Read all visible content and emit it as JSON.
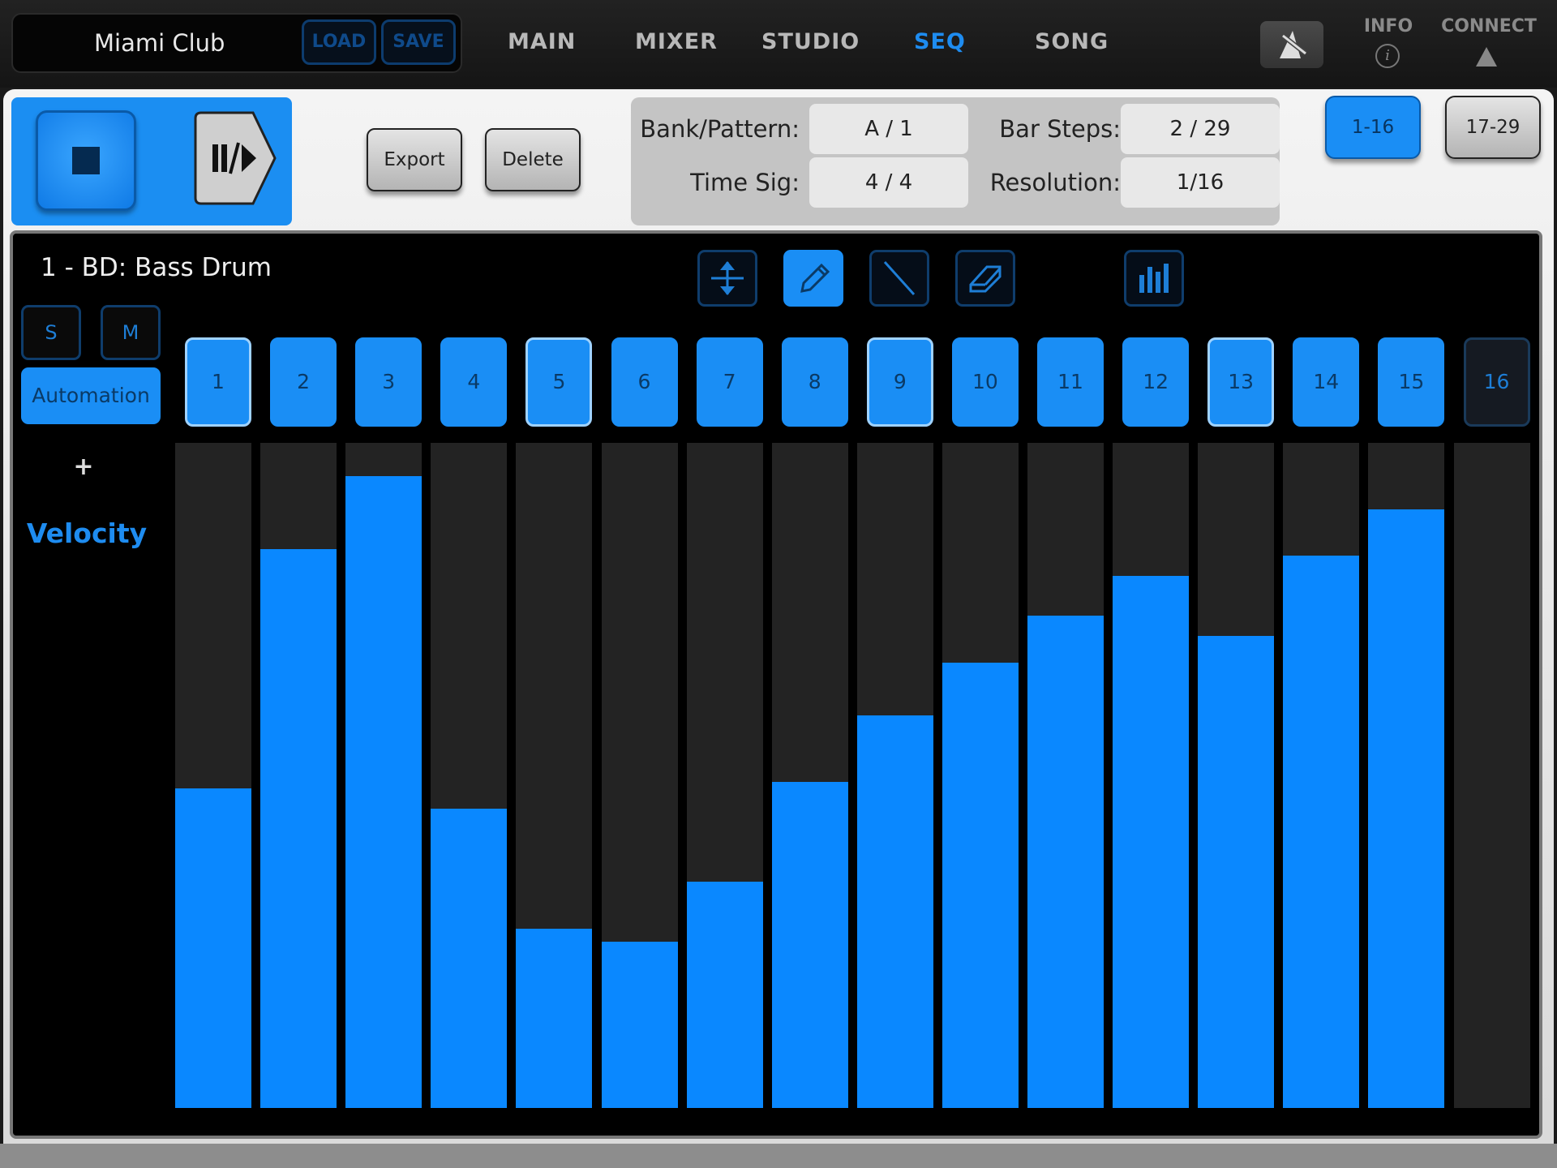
{
  "header": {
    "preset_name": "Miami Club",
    "load_label": "LOAD",
    "save_label": "SAVE",
    "nav": [
      {
        "label": "MAIN",
        "active": false
      },
      {
        "label": "MIXER",
        "active": false
      },
      {
        "label": "STUDIO",
        "active": false
      },
      {
        "label": "SEQ",
        "active": true
      },
      {
        "label": "SONG",
        "active": false
      }
    ],
    "info_label": "INFO",
    "connect_label": "CONNECT"
  },
  "transport": {
    "stop_icon": "stop-icon",
    "play_icon": "pause-play-icon"
  },
  "actions": {
    "export_label": "Export",
    "delete_label": "Delete"
  },
  "pattern_info": {
    "bank_pattern_label": "Bank/Pattern:",
    "bank_pattern_value": "A / 1",
    "bar_steps_label": "Bar Steps:",
    "bar_steps_value": "2 / 29",
    "time_sig_label": "Time Sig:",
    "time_sig_value": "4 / 4",
    "resolution_label": "Resolution:",
    "resolution_value": "1/16"
  },
  "pages": [
    {
      "label": "1-16",
      "active": true
    },
    {
      "label": "17-29",
      "active": false
    }
  ],
  "sequencer": {
    "track_name": "1 - BD: Bass Drum",
    "solo_label": "S",
    "mute_label": "M",
    "automation_label": "Automation",
    "plus_label": "+",
    "param_label": "Velocity",
    "tools": [
      {
        "name": "move-vertical-icon",
        "active": false
      },
      {
        "name": "pencil-icon",
        "active": true
      },
      {
        "name": "line-icon",
        "active": false
      },
      {
        "name": "eraser-icon",
        "active": false
      },
      {
        "name": "bar-graph-icon",
        "active": false
      }
    ],
    "accent_color": "#0a88ff",
    "steps": [
      {
        "label": "1",
        "state": "ring",
        "velocity": 0.48
      },
      {
        "label": "2",
        "state": "on",
        "velocity": 0.84
      },
      {
        "label": "3",
        "state": "on",
        "velocity": 0.95
      },
      {
        "label": "4",
        "state": "on",
        "velocity": 0.45
      },
      {
        "label": "5",
        "state": "ring",
        "velocity": 0.27
      },
      {
        "label": "6",
        "state": "on",
        "velocity": 0.25
      },
      {
        "label": "7",
        "state": "on",
        "velocity": 0.34
      },
      {
        "label": "8",
        "state": "on",
        "velocity": 0.49
      },
      {
        "label": "9",
        "state": "ring",
        "velocity": 0.59
      },
      {
        "label": "10",
        "state": "on",
        "velocity": 0.67
      },
      {
        "label": "11",
        "state": "on",
        "velocity": 0.74
      },
      {
        "label": "12",
        "state": "on",
        "velocity": 0.8
      },
      {
        "label": "13",
        "state": "ring",
        "velocity": 0.71
      },
      {
        "label": "14",
        "state": "on",
        "velocity": 0.83
      },
      {
        "label": "15",
        "state": "on",
        "velocity": 0.9
      },
      {
        "label": "16",
        "state": "off",
        "velocity": 0
      }
    ]
  }
}
